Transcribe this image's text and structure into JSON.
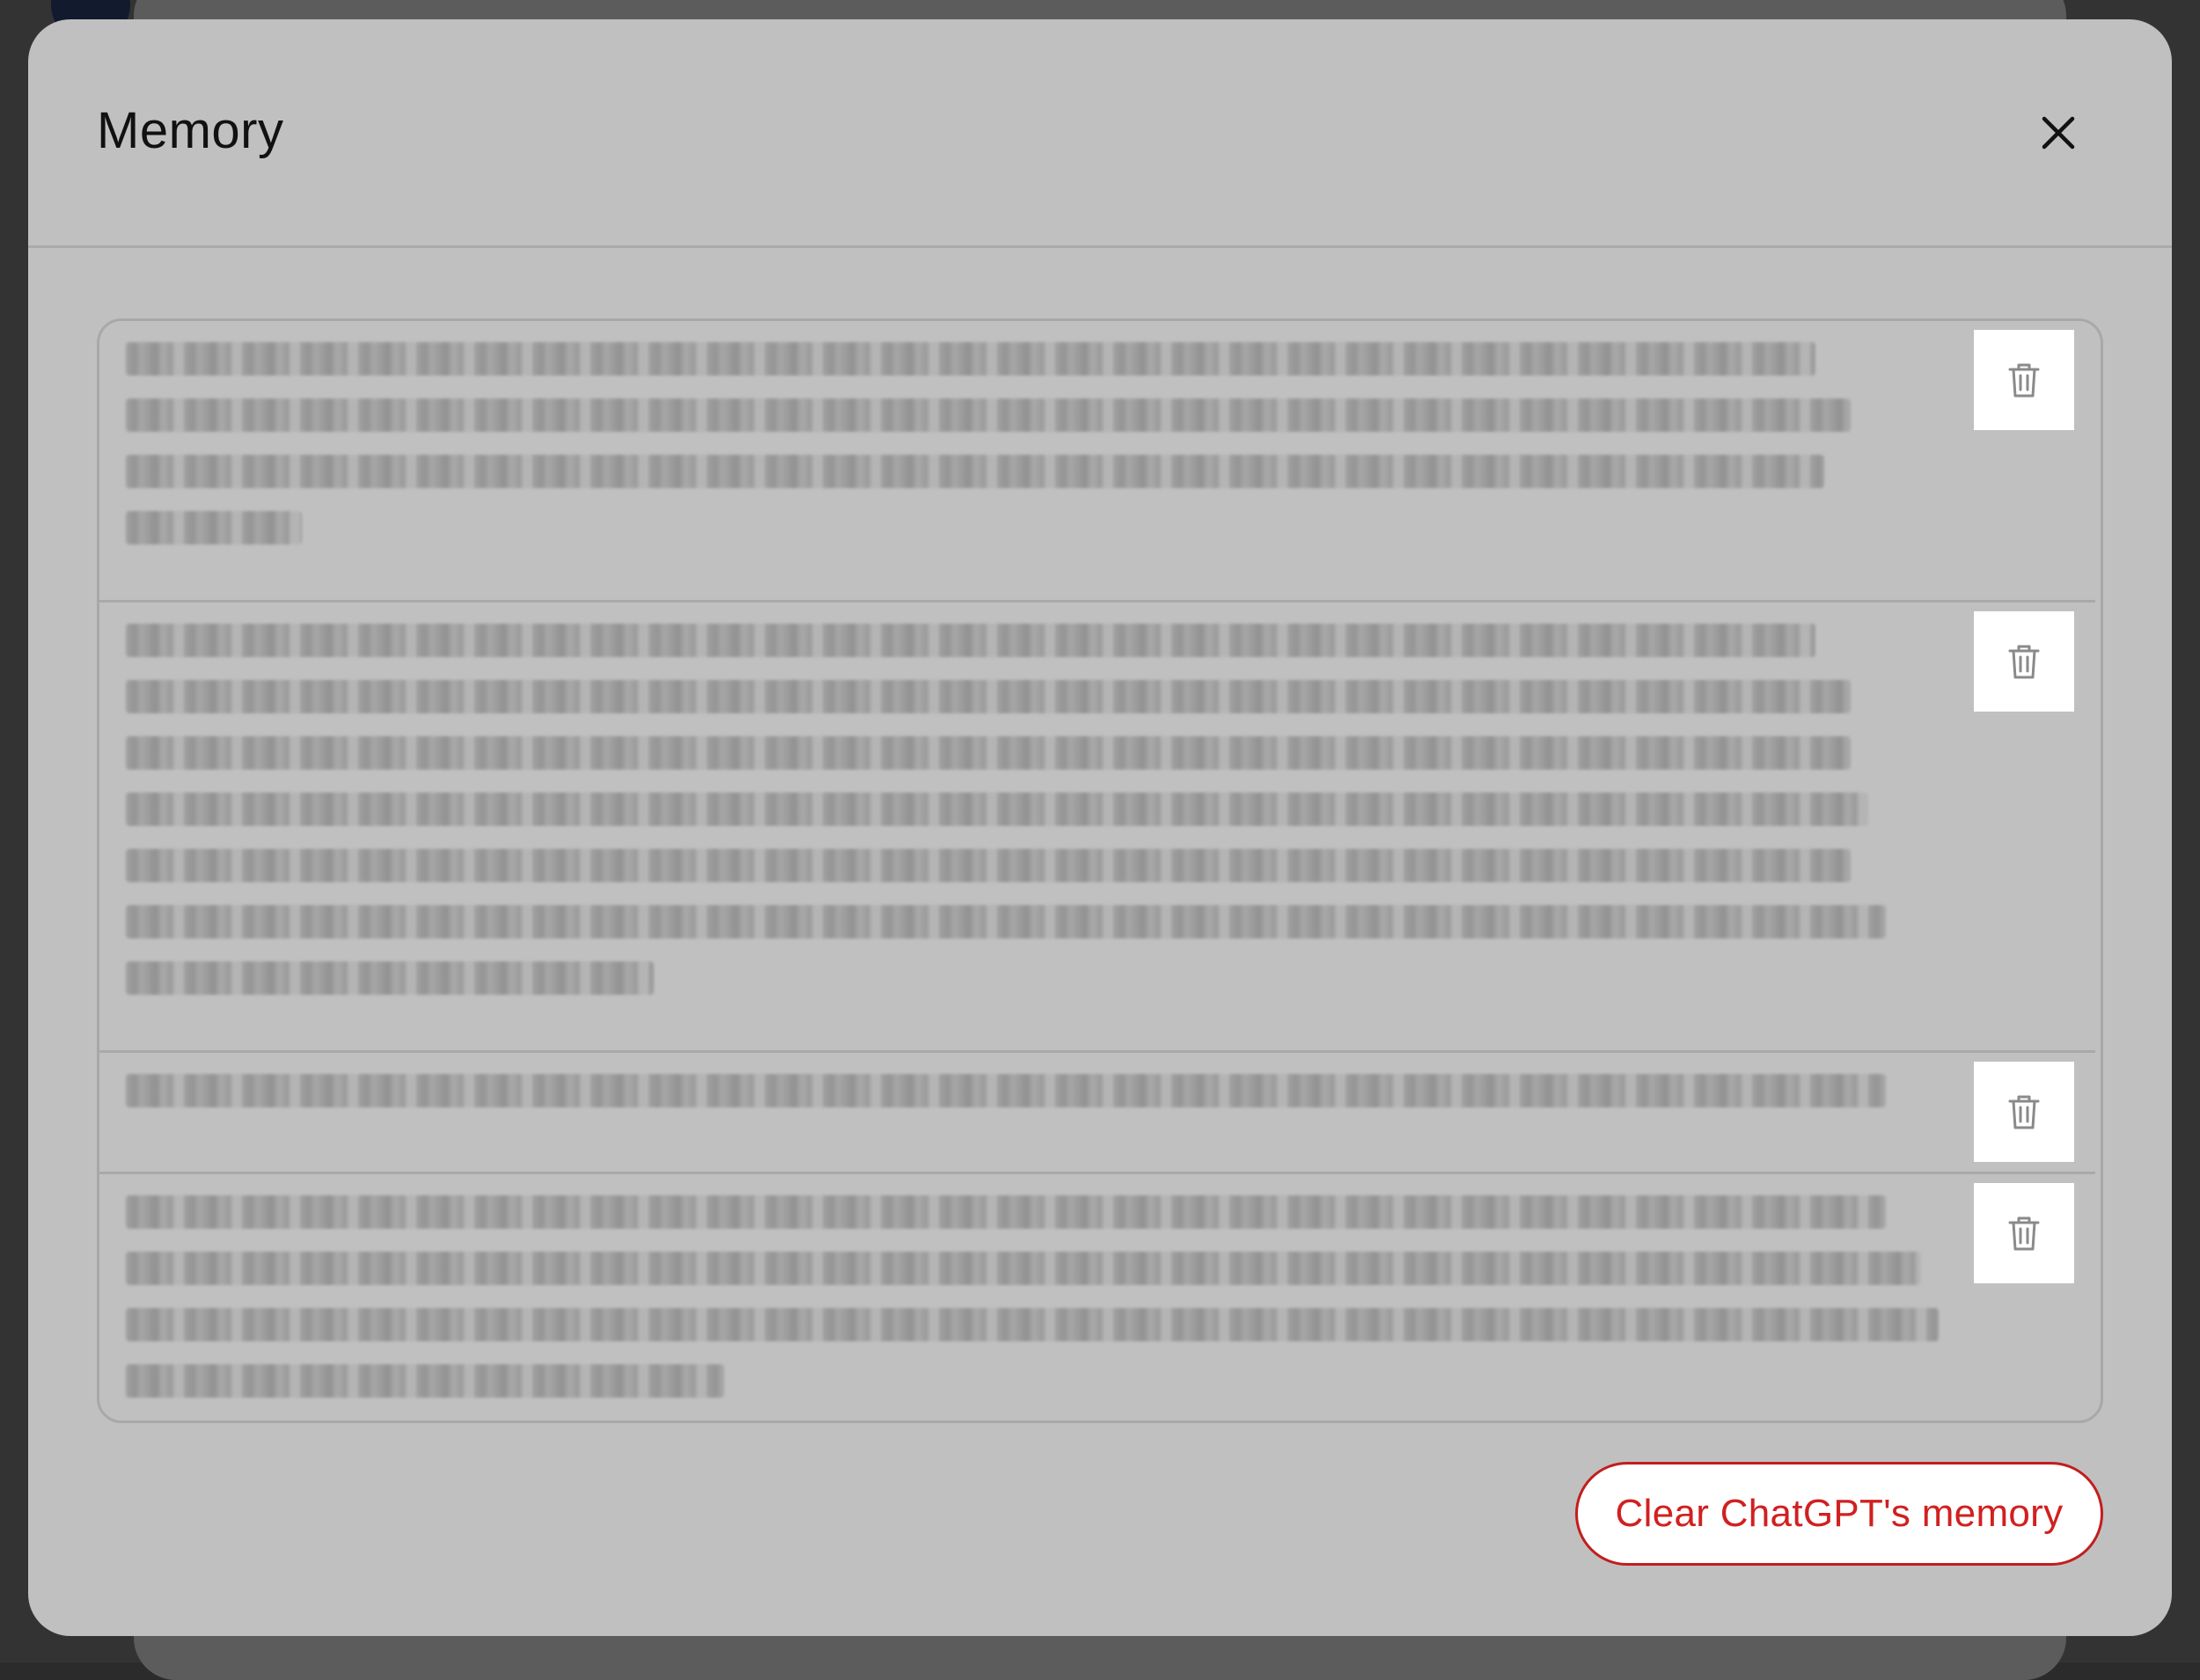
{
  "background": {
    "overlay_color": "#2b2b2b"
  },
  "modal": {
    "title": "Memory",
    "close_icon": "close-icon",
    "memories": [
      {
        "text": "",
        "redacted": true,
        "delete_icon": "trash-icon"
      },
      {
        "text": "",
        "redacted": true,
        "delete_icon": "trash-icon"
      },
      {
        "text": "",
        "redacted": true,
        "delete_icon": "trash-icon"
      },
      {
        "text": "",
        "redacted": true,
        "delete_icon": "trash-icon"
      }
    ],
    "clear_button_label": "Clear ChatGPT's memory",
    "colors": {
      "danger": "#d12020",
      "modal_bg": "#c0c0c0"
    }
  }
}
